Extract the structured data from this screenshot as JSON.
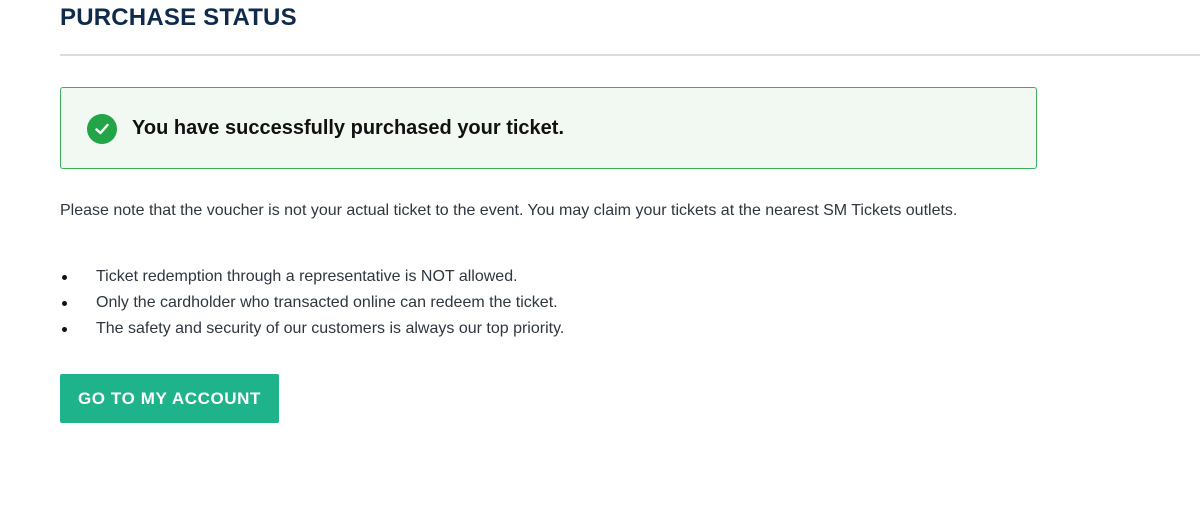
{
  "page_title": "PURCHASE STATUS",
  "alert": {
    "icon": "check-circle-icon",
    "message": "You have successfully purchased your ticket.",
    "color": "#22a447",
    "background": "#f1f9f2"
  },
  "note": "Please note that the voucher is not your actual ticket to the event. You may claim your tickets at the nearest SM Tickets outlets.",
  "rules": [
    "Ticket redemption through a representative is NOT allowed.",
    "Only the cardholder who transacted online can redeem the ticket.",
    "The safety and security of our customers is always our top priority."
  ],
  "button": {
    "label": "GO TO MY ACCOUNT",
    "color": "#1fb38b"
  },
  "title_color": "#0f2a4a"
}
